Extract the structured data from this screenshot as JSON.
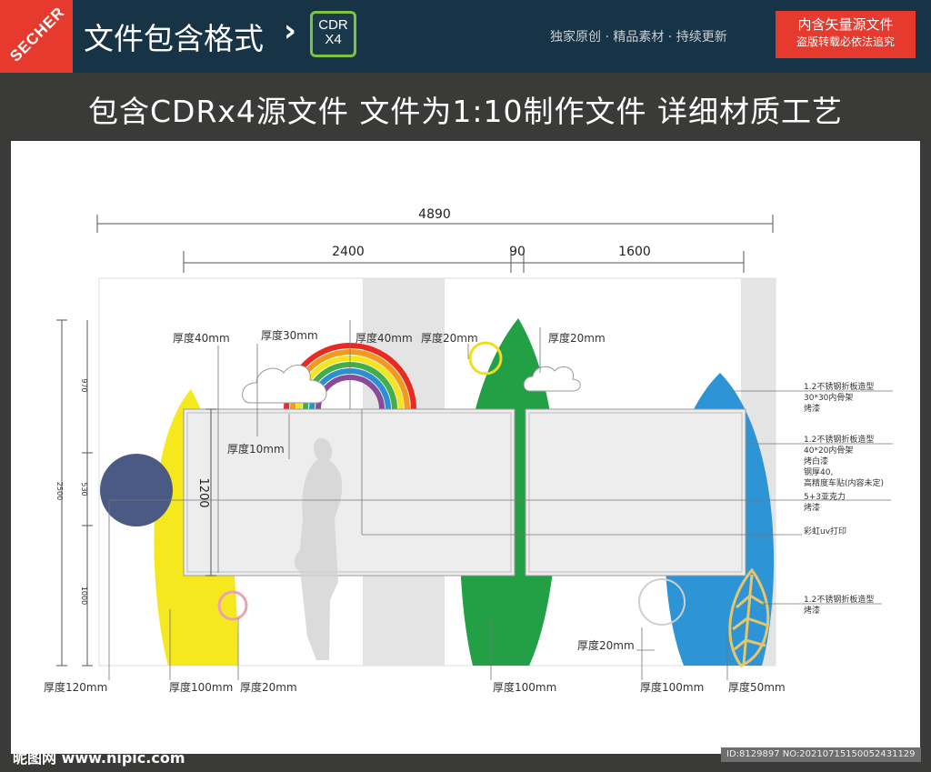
{
  "header": {
    "brand": "SECHER",
    "title": "文件包含格式",
    "chevron": "›",
    "badge_line1": "CDR",
    "badge_line2": "X4",
    "slogan": "独家原创 · 精品素材 · 持续更新",
    "red_line1": "内含矢量源文件",
    "red_line2": "盗版转载必依法追究",
    "colors": {
      "bar": "#173447",
      "brand": "#e53a2d",
      "badge_border": "#7dc242"
    }
  },
  "subtitle": "包含CDRx4源文件   文件为1:10制作文件  详细材质工艺",
  "drawing": {
    "dims": {
      "total": "4890",
      "left": "2400",
      "gap": "90",
      "right": "1600",
      "height": "2500",
      "seg_top": "970",
      "seg_mid": "530",
      "seg_bot": "1000",
      "board_h": "1200"
    },
    "thickness": {
      "t40a": "厚度40mm",
      "t30": "厚度30mm",
      "t40b": "厚度40mm",
      "t20a": "厚度20mm",
      "t20b": "厚度20mm",
      "t10": "厚度10mm",
      "t20c": "厚度20mm",
      "t120": "厚度120mm",
      "t100a": "厚度100mm",
      "t20d": "厚度20mm",
      "t100b": "厚度100mm",
      "t100c": "厚度100mm",
      "t50": "厚度50mm"
    },
    "notes": {
      "n1_l1": "1.2不锈钢折板造型",
      "n1_l2": "30*30内骨架",
      "n1_l3": "烤漆",
      "n2_l1": "1.2不锈钢折板造型",
      "n2_l2": "40*20内骨架",
      "n2_l3": "烤白漆",
      "n2_l4": "钢厚40,",
      "n2_l5": "高精度车贴(内容未定)",
      "n3_l1": "5+3亚克力",
      "n3_l2": "烤漆",
      "n4_l1": "彩虹uv打印",
      "n5_l1": "1.2不锈钢折板造型",
      "n5_l2": "烤漆"
    },
    "colors": {
      "yellow_leaf": "#f6e81f",
      "green_leaf": "#23a046",
      "blue_leaf": "#2d94d6",
      "navy_circle": "#4a5a85",
      "gold_leaf": "#e6c66a",
      "board": "#ededed",
      "panel": "#e4e4e4"
    },
    "rainbow_colors": [
      "#e82a23",
      "#f39a1d",
      "#f5e61b",
      "#43ad49",
      "#2b8fd3",
      "#8a4a9c"
    ]
  },
  "footer": {
    "watermark": "昵图网 www.nipic.com",
    "id_text": "ID:8129897 NO:20210715150052431129"
  }
}
